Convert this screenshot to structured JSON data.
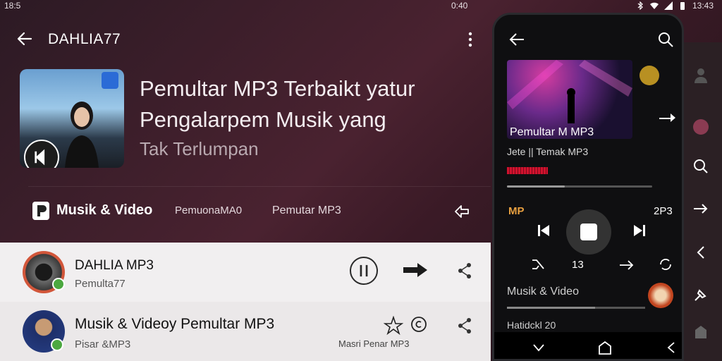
{
  "status_bar": {
    "time_left": "18:5",
    "center": "0:40",
    "time_right": "13:43"
  },
  "header": {
    "title": "DAHLIA77"
  },
  "hero": {
    "headline_line1": "Pemultar MP3 Terbaikt yatur",
    "headline_line2": "Pengalarpem Musik yang",
    "subline": "Tak Terlumpan"
  },
  "tabs": {
    "main": "Musik & Video",
    "second": "PemuonaMA0",
    "third": "Pemutar MP3"
  },
  "list": [
    {
      "title": "DAHLIA MP3",
      "subtitle": "Pemulta77"
    },
    {
      "title": "Musik & Videoy Pemultar MP3",
      "subtitle": "Pisar &MP3",
      "small": "Masri Penar MP3"
    }
  ],
  "phone": {
    "cover_title": "Pemultar M MP3",
    "subtitle": "Jete || Temak MP3",
    "logo": "MP",
    "time": "2P3",
    "count": "13",
    "label": "Musik & Video",
    "footer": "Hatidckl 20"
  },
  "colors": {
    "accent_red": "#d2122e",
    "online_green": "#4ca840"
  }
}
